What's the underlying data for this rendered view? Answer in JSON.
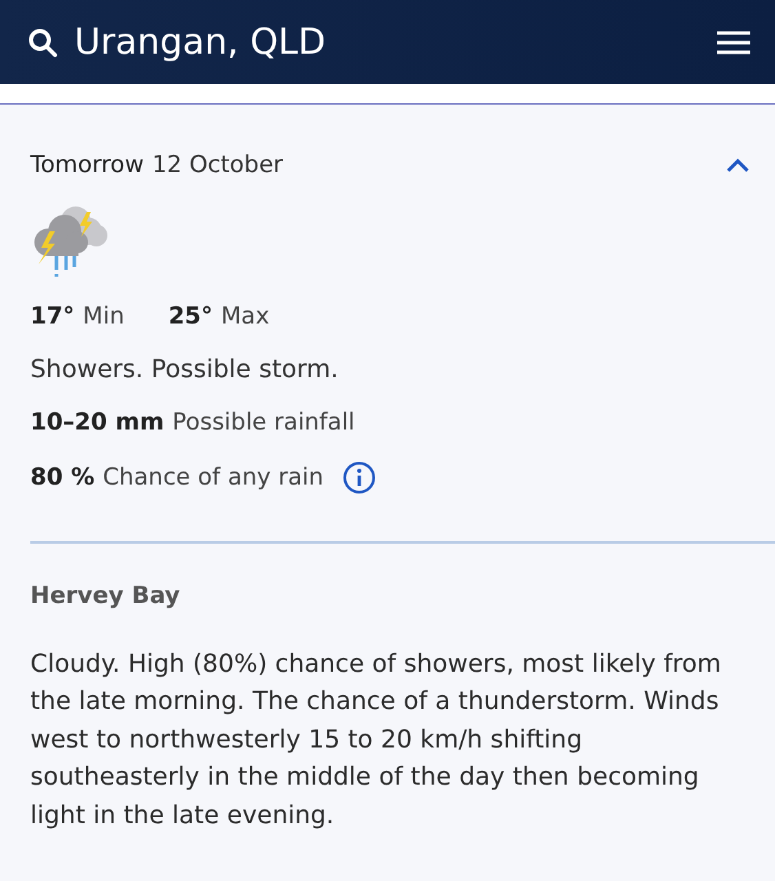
{
  "header": {
    "location": "Urangan, QLD"
  },
  "day": {
    "day_label": "Tomorrow",
    "date": "12 October",
    "expanded": true,
    "min": {
      "value": "17°",
      "label": "Min"
    },
    "max": {
      "value": "25°",
      "label": "Max"
    },
    "summary": "Showers. Possible storm.",
    "rainfall": {
      "value": "10–20 mm",
      "label": "Possible rainfall"
    },
    "rain_chance": {
      "value": "80 %",
      "label": "Chance of any rain"
    }
  },
  "district": {
    "name": "Hervey Bay",
    "forecast": "Cloudy. High (80%) chance of showers, most likely from the late morning. The chance of a thunderstorm. Winds west to northwesterly 15 to 20 km/h shifting southeasterly in the middle of the day then becoming light in the late evening."
  }
}
